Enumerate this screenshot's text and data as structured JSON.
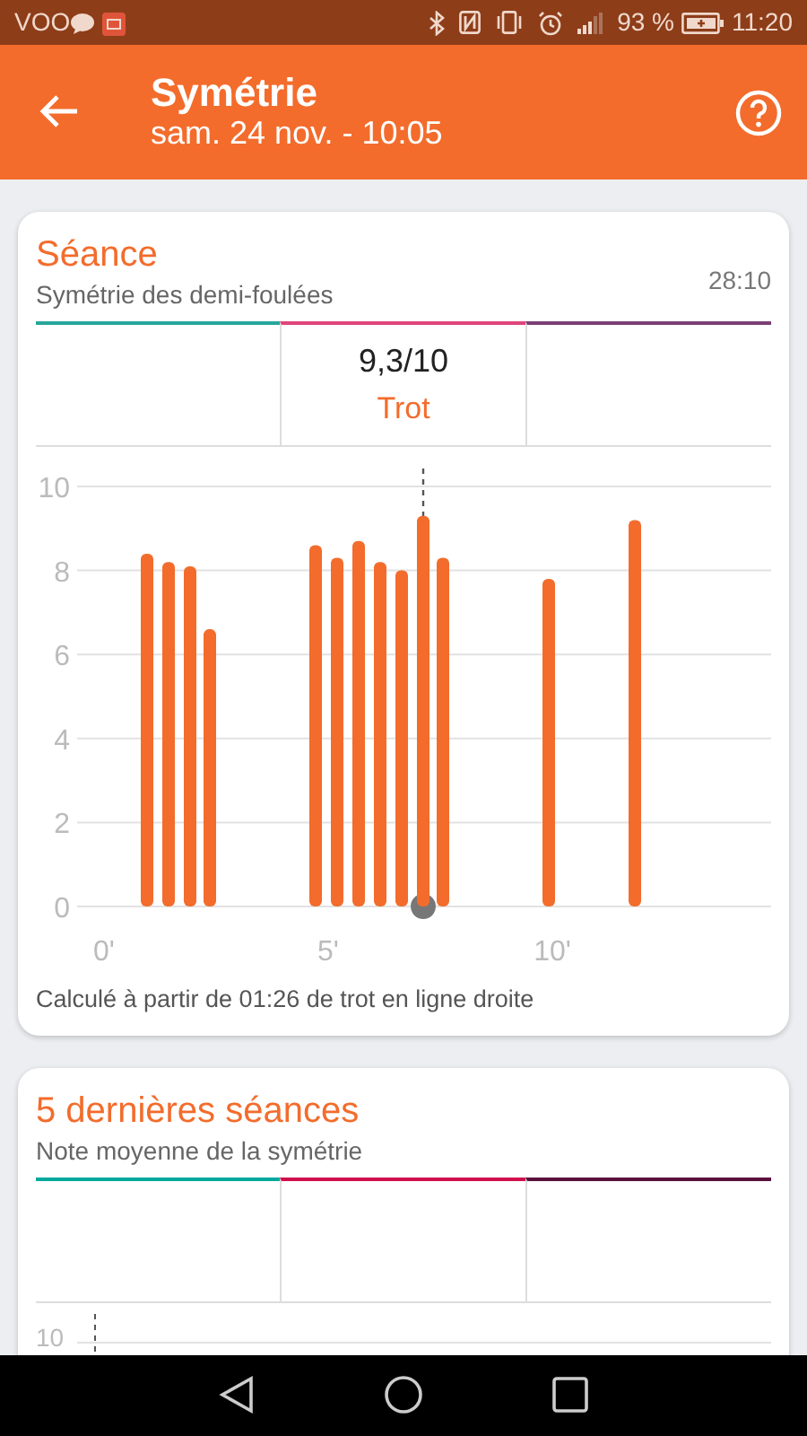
{
  "status_bar": {
    "carrier": "VOO",
    "battery": "93 %",
    "time": "11:20"
  },
  "app_bar": {
    "title": "Symétrie",
    "subtitle": "sam. 24 nov. - 10:05"
  },
  "cards": [
    {
      "title": "Séance",
      "subtitle": "Symétrie des demi-foulées",
      "duration": "28:10",
      "stat_columns": [
        {
          "color": "#26a69a"
        },
        {
          "color": "#e0457b",
          "value": "9,3/10",
          "label": "Trot"
        },
        {
          "color": "#7b3f74"
        }
      ],
      "chart_data": {
        "type": "bar",
        "x": [
          0.96,
          1.44,
          1.92,
          2.36,
          4.72,
          5.2,
          5.68,
          6.16,
          6.64,
          7.12,
          7.56,
          9.92,
          11.84
        ],
        "series": [
          {
            "color": "#f36c2c",
            "values": [
              8.4,
              8.2,
              8.1,
              6.6,
              8.6,
              8.3,
              8.7,
              8.2,
              8.0,
              9.3,
              8.3,
              7.8,
              9.2
            ]
          }
        ],
        "xlim": [
          -0.6,
          14.88
        ],
        "ylim": [
          0,
          10
        ],
        "grid": true,
        "yticks": [
          0,
          2,
          4,
          6,
          8,
          10
        ],
        "xticks": [
          {
            "value": 0,
            "label": "0'"
          },
          {
            "value": 5,
            "label": "5'"
          },
          {
            "value": 10,
            "label": "10'"
          }
        ],
        "ref_lines": [
          {
            "axis": "x",
            "value": 7.12
          }
        ]
      },
      "footnote": "Calculé à partir de 01:26 de trot en ligne droite"
    },
    {
      "title": "5 dernières séances",
      "subtitle": "Note moyenne de la symétrie",
      "stat_columns": [
        {
          "color": "#00a99d"
        },
        {
          "color": "#d0104c"
        },
        {
          "color": "#5a0f3c"
        }
      ],
      "axis_top_tick": "10"
    }
  ]
}
